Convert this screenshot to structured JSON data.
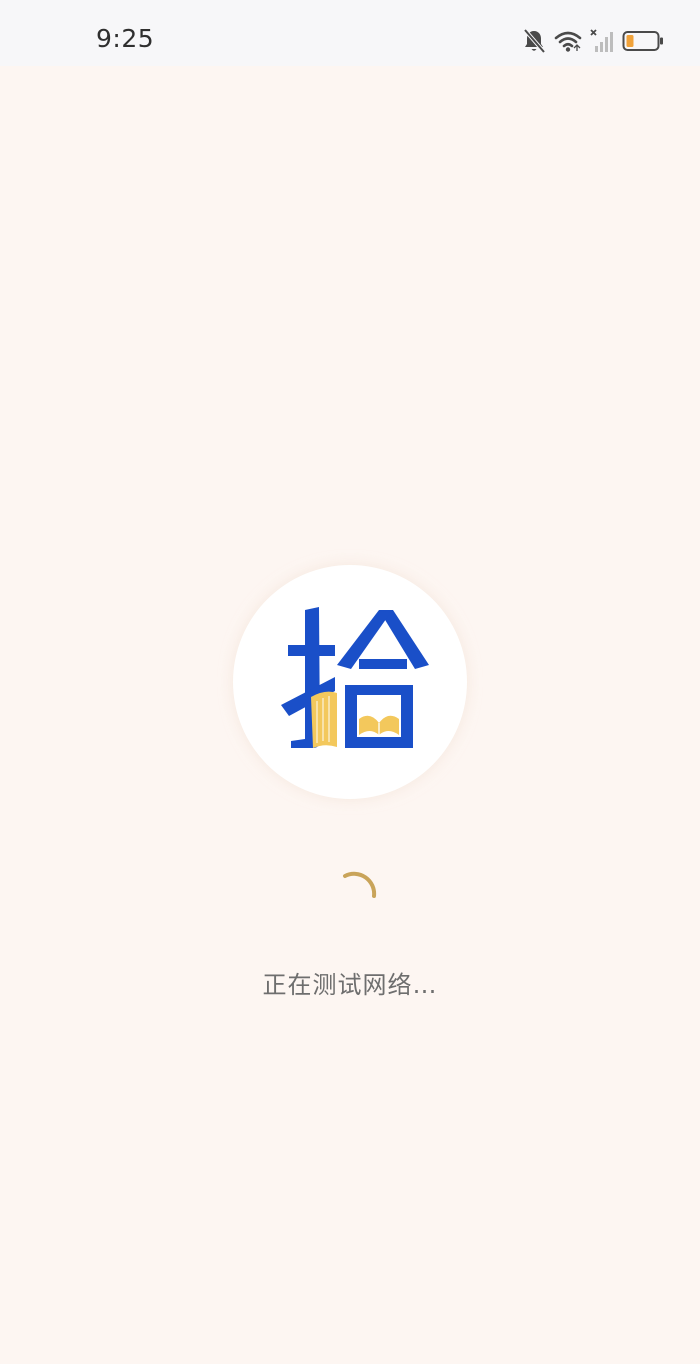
{
  "status_bar": {
    "time": "9:25",
    "icons": [
      "bell-muted-icon",
      "wifi-icon",
      "cellular-no-signal-icon",
      "battery-low-icon"
    ],
    "battery_color": "#f0a23a"
  },
  "splash": {
    "logo_glyph": "拾",
    "logo_colors": {
      "blue": "#1a4fc8",
      "gold": "#f3c85c"
    },
    "message": "正在测试网络…",
    "spinner_color": "#c9a45a"
  }
}
